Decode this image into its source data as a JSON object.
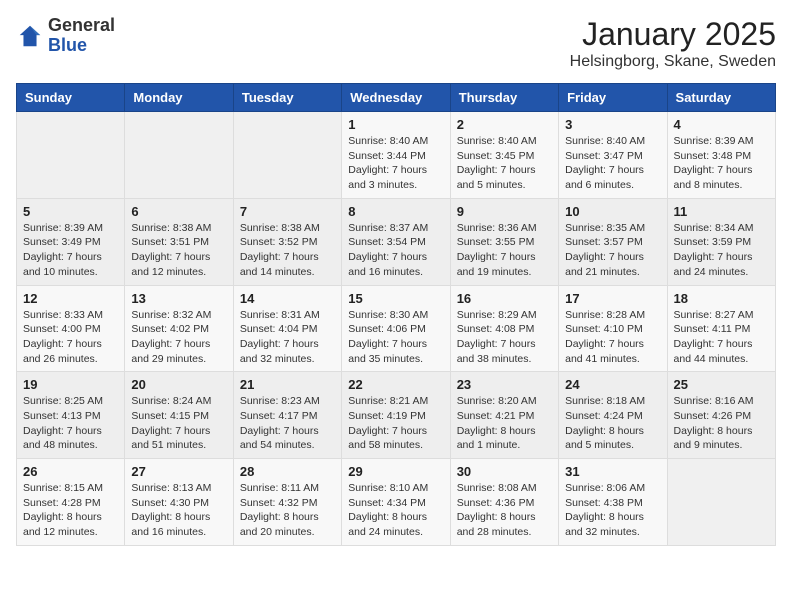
{
  "header": {
    "logo_general": "General",
    "logo_blue": "Blue",
    "month_title": "January 2025",
    "subtitle": "Helsingborg, Skane, Sweden"
  },
  "weekdays": [
    "Sunday",
    "Monday",
    "Tuesday",
    "Wednesday",
    "Thursday",
    "Friday",
    "Saturday"
  ],
  "weeks": [
    [
      {
        "day": "",
        "info": ""
      },
      {
        "day": "",
        "info": ""
      },
      {
        "day": "",
        "info": ""
      },
      {
        "day": "1",
        "info": "Sunrise: 8:40 AM\nSunset: 3:44 PM\nDaylight: 7 hours\nand 3 minutes."
      },
      {
        "day": "2",
        "info": "Sunrise: 8:40 AM\nSunset: 3:45 PM\nDaylight: 7 hours\nand 5 minutes."
      },
      {
        "day": "3",
        "info": "Sunrise: 8:40 AM\nSunset: 3:47 PM\nDaylight: 7 hours\nand 6 minutes."
      },
      {
        "day": "4",
        "info": "Sunrise: 8:39 AM\nSunset: 3:48 PM\nDaylight: 7 hours\nand 8 minutes."
      }
    ],
    [
      {
        "day": "5",
        "info": "Sunrise: 8:39 AM\nSunset: 3:49 PM\nDaylight: 7 hours\nand 10 minutes."
      },
      {
        "day": "6",
        "info": "Sunrise: 8:38 AM\nSunset: 3:51 PM\nDaylight: 7 hours\nand 12 minutes."
      },
      {
        "day": "7",
        "info": "Sunrise: 8:38 AM\nSunset: 3:52 PM\nDaylight: 7 hours\nand 14 minutes."
      },
      {
        "day": "8",
        "info": "Sunrise: 8:37 AM\nSunset: 3:54 PM\nDaylight: 7 hours\nand 16 minutes."
      },
      {
        "day": "9",
        "info": "Sunrise: 8:36 AM\nSunset: 3:55 PM\nDaylight: 7 hours\nand 19 minutes."
      },
      {
        "day": "10",
        "info": "Sunrise: 8:35 AM\nSunset: 3:57 PM\nDaylight: 7 hours\nand 21 minutes."
      },
      {
        "day": "11",
        "info": "Sunrise: 8:34 AM\nSunset: 3:59 PM\nDaylight: 7 hours\nand 24 minutes."
      }
    ],
    [
      {
        "day": "12",
        "info": "Sunrise: 8:33 AM\nSunset: 4:00 PM\nDaylight: 7 hours\nand 26 minutes."
      },
      {
        "day": "13",
        "info": "Sunrise: 8:32 AM\nSunset: 4:02 PM\nDaylight: 7 hours\nand 29 minutes."
      },
      {
        "day": "14",
        "info": "Sunrise: 8:31 AM\nSunset: 4:04 PM\nDaylight: 7 hours\nand 32 minutes."
      },
      {
        "day": "15",
        "info": "Sunrise: 8:30 AM\nSunset: 4:06 PM\nDaylight: 7 hours\nand 35 minutes."
      },
      {
        "day": "16",
        "info": "Sunrise: 8:29 AM\nSunset: 4:08 PM\nDaylight: 7 hours\nand 38 minutes."
      },
      {
        "day": "17",
        "info": "Sunrise: 8:28 AM\nSunset: 4:10 PM\nDaylight: 7 hours\nand 41 minutes."
      },
      {
        "day": "18",
        "info": "Sunrise: 8:27 AM\nSunset: 4:11 PM\nDaylight: 7 hours\nand 44 minutes."
      }
    ],
    [
      {
        "day": "19",
        "info": "Sunrise: 8:25 AM\nSunset: 4:13 PM\nDaylight: 7 hours\nand 48 minutes."
      },
      {
        "day": "20",
        "info": "Sunrise: 8:24 AM\nSunset: 4:15 PM\nDaylight: 7 hours\nand 51 minutes."
      },
      {
        "day": "21",
        "info": "Sunrise: 8:23 AM\nSunset: 4:17 PM\nDaylight: 7 hours\nand 54 minutes."
      },
      {
        "day": "22",
        "info": "Sunrise: 8:21 AM\nSunset: 4:19 PM\nDaylight: 7 hours\nand 58 minutes."
      },
      {
        "day": "23",
        "info": "Sunrise: 8:20 AM\nSunset: 4:21 PM\nDaylight: 8 hours\nand 1 minute."
      },
      {
        "day": "24",
        "info": "Sunrise: 8:18 AM\nSunset: 4:24 PM\nDaylight: 8 hours\nand 5 minutes."
      },
      {
        "day": "25",
        "info": "Sunrise: 8:16 AM\nSunset: 4:26 PM\nDaylight: 8 hours\nand 9 minutes."
      }
    ],
    [
      {
        "day": "26",
        "info": "Sunrise: 8:15 AM\nSunset: 4:28 PM\nDaylight: 8 hours\nand 12 minutes."
      },
      {
        "day": "27",
        "info": "Sunrise: 8:13 AM\nSunset: 4:30 PM\nDaylight: 8 hours\nand 16 minutes."
      },
      {
        "day": "28",
        "info": "Sunrise: 8:11 AM\nSunset: 4:32 PM\nDaylight: 8 hours\nand 20 minutes."
      },
      {
        "day": "29",
        "info": "Sunrise: 8:10 AM\nSunset: 4:34 PM\nDaylight: 8 hours\nand 24 minutes."
      },
      {
        "day": "30",
        "info": "Sunrise: 8:08 AM\nSunset: 4:36 PM\nDaylight: 8 hours\nand 28 minutes."
      },
      {
        "day": "31",
        "info": "Sunrise: 8:06 AM\nSunset: 4:38 PM\nDaylight: 8 hours\nand 32 minutes."
      },
      {
        "day": "",
        "info": ""
      }
    ]
  ]
}
